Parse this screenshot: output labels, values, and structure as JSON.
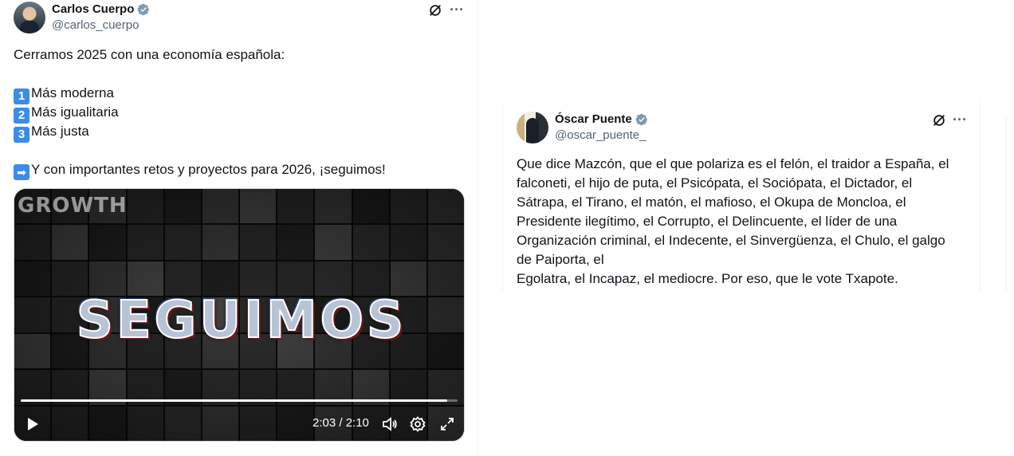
{
  "tweets": [
    {
      "author": {
        "name": "Carlos Cuerpo",
        "handle": "@carlos_cuerpo",
        "verified": true
      },
      "lines": [
        {
          "text": "Cerramos 2025 con una economía española:"
        },
        {
          "text": ""
        },
        {
          "emoji": "1",
          "text": "Más moderna"
        },
        {
          "emoji": "2",
          "text": "Más igualitaria"
        },
        {
          "emoji": "3",
          "text": "Más justa"
        },
        {
          "text": ""
        },
        {
          "emoji": "➡",
          "text": "Y con importantes retos y proyectos para 2026, ¡seguimos!"
        }
      ],
      "video": {
        "overlay_text": "SEGUIMOS",
        "background_word": "GROWTH",
        "time": "2:03 / 2:10",
        "progress": 0.977,
        "icons": [
          "play-icon",
          "volume-icon",
          "settings-icon",
          "fullscreen-icon"
        ]
      }
    },
    {
      "author": {
        "name": "Óscar Puente",
        "handle": "@oscar_puente_",
        "verified": true
      },
      "lines": [
        {
          "text": "Que dice Mazcón, que el que polariza es el felón, el traidor a España, el"
        },
        {
          "text": "falconeti, el hijo de puta, el Psicópata, el Sociópata, el Dictador, el"
        },
        {
          "text": "Sátrapa, el Tirano, el matón, el mafioso, el Okupa de Moncloa, el"
        },
        {
          "text": "Presidente ilegítimo, el Corrupto, el Delincuente, el líder de una"
        },
        {
          "text": "Organización criminal, el Indecente, el Sinvergüenza, el Chulo, el galgo"
        },
        {
          "text": "de Paiporta, el"
        },
        {
          "text": "Egolatra, el Incapaz, el mediocre. Por eso, que le vote Txapote."
        }
      ]
    }
  ],
  "colors": {
    "text": "#0f1419",
    "secondary": "#536471",
    "verified": "#829aab",
    "emoji_bg": "#3c8ce6",
    "border": "#eff3f4"
  }
}
